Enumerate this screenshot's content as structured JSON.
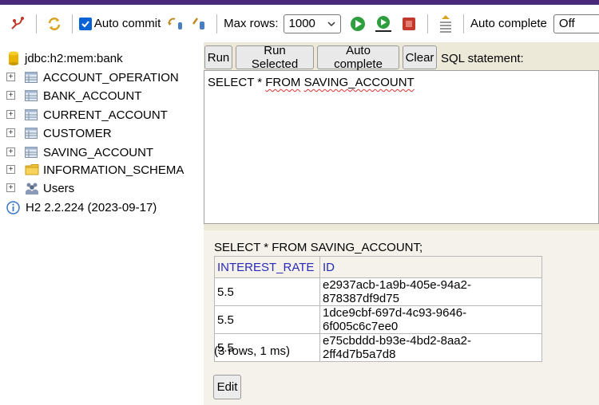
{
  "toolbar": {
    "auto_commit_label": "Auto commit",
    "max_rows_label": "Max rows:",
    "max_rows_value": "1000",
    "auto_complete_label": "Auto complete",
    "auto_complete_value": "Off"
  },
  "tree": {
    "root": "jdbc:h2:mem:bank",
    "items": [
      {
        "label": "ACCOUNT_OPERATION"
      },
      {
        "label": "BANK_ACCOUNT"
      },
      {
        "label": "CURRENT_ACCOUNT"
      },
      {
        "label": "CUSTOMER"
      },
      {
        "label": "SAVING_ACCOUNT"
      },
      {
        "label": "INFORMATION_SCHEMA"
      },
      {
        "label": "Users"
      }
    ],
    "version": "H2 2.2.224 (2023-09-17)"
  },
  "actions": {
    "run": "Run",
    "run_selected": "Run Selected",
    "auto_complete": "Auto complete",
    "clear": "Clear",
    "sql_statement_label": "SQL statement:"
  },
  "editor": {
    "prefix": "SELECT * ",
    "from": "FROM",
    "space": " ",
    "table": "SAVING_ACCOUNT"
  },
  "result": {
    "sql": "SELECT * FROM SAVING_ACCOUNT;",
    "columns": [
      "INTEREST_RATE",
      "ID"
    ],
    "rows": [
      [
        "5.5",
        "e2937acb-1a9b-405e-94a2-878387df9d75"
      ],
      [
        "5.5",
        "1dce9cbf-697d-4c93-9646-6f005c6c7ee0"
      ],
      [
        "5.5",
        "e75cbddd-b93e-4bd2-8aa2-2ff4d7b5a7d8"
      ]
    ],
    "info": "(3 rows, 1 ms)",
    "edit_label": "Edit"
  }
}
